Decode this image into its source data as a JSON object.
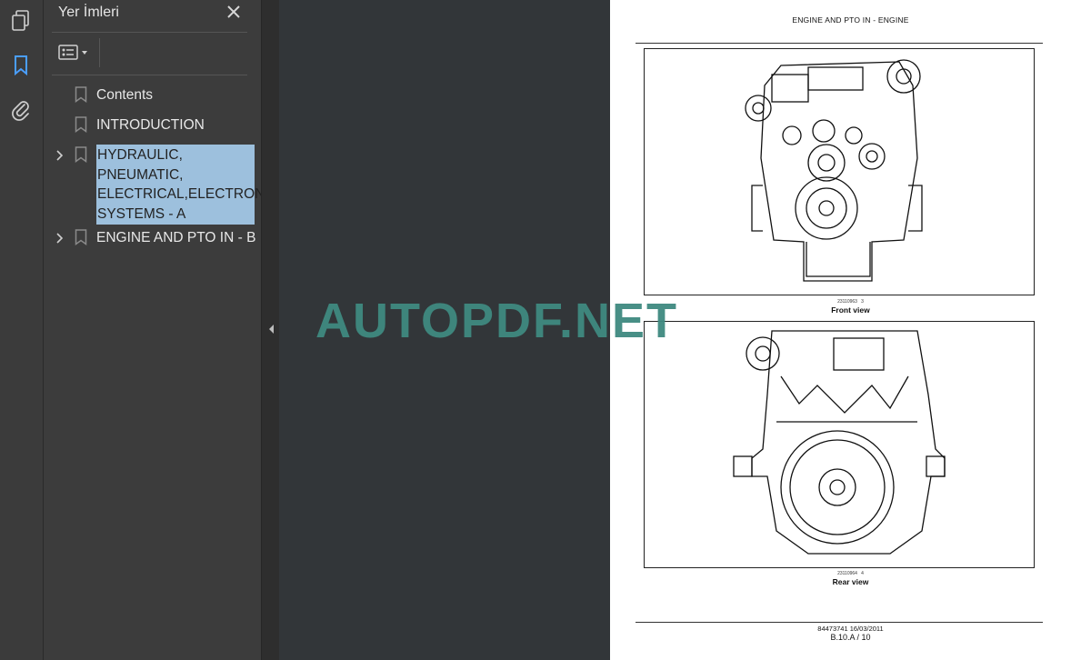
{
  "sidebar_rail": {
    "icons": [
      "pages-icon",
      "bookmark-icon",
      "attachment-icon"
    ],
    "active": "bookmark-icon",
    "accent_color": "#4a9eff"
  },
  "bookmarks_panel": {
    "title": "Yer İmleri",
    "items": [
      {
        "label": "Contents",
        "expandable": false,
        "selected": false
      },
      {
        "label": "INTRODUCTION",
        "expandable": false,
        "selected": false
      },
      {
        "label": "HYDRAULIC,\nPNEUMATIC,\nELECTRICAL,ELECTRONIC\nSYSTEMS - A",
        "expandable": true,
        "selected": true
      },
      {
        "label": "ENGINE AND PTO IN - B",
        "expandable": true,
        "selected": false
      }
    ],
    "selection_color": "#9dc0dd"
  },
  "document": {
    "header": "ENGINE AND PTO IN - ENGINE",
    "figures": [
      {
        "id": "23110963",
        "num": "3",
        "caption": "Front view"
      },
      {
        "id": "23110964",
        "num": "4",
        "caption": "Rear view"
      }
    ],
    "footer_line1": "84473741 16/03/2011",
    "footer_line2": "B.10.A / 10"
  },
  "watermark": "AUTOPDF.NET"
}
